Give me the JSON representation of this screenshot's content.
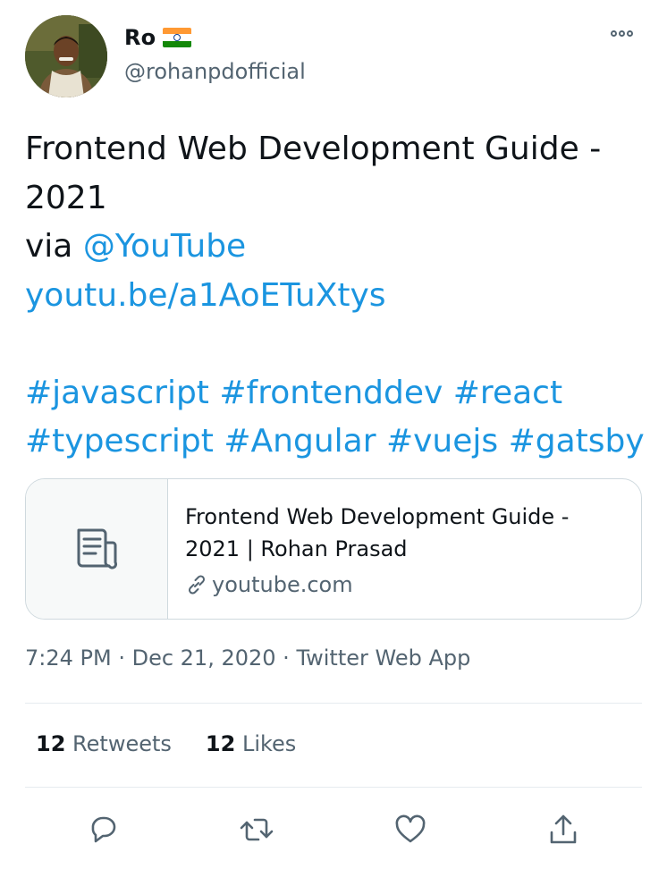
{
  "author": {
    "name": "Ro",
    "handle": "@rohanpdofficial",
    "flag": "india-flag-icon"
  },
  "tweet": {
    "line1": "Frontend Web Development Guide - 2021",
    "via_prefix": "via ",
    "mention": "@YouTube",
    "url": "youtu.be/a1AoETuXtys",
    "hashtags": [
      "#javascript",
      "#frontenddev",
      "#react",
      "#typescript",
      "#Angular",
      "#vuejs",
      "#gatsby"
    ]
  },
  "card": {
    "title": "Frontend Web Development Guide - 2021 | Rohan Prasad",
    "domain": "youtube.com"
  },
  "meta": {
    "time": "7:24 PM",
    "date": "Dec 21, 2020",
    "source": "Twitter Web App",
    "sep": " · "
  },
  "stats": {
    "retweets_count": "12",
    "retweets_label": "Retweets",
    "likes_count": "12",
    "likes_label": "Likes"
  },
  "colors": {
    "link": "#1b95e0",
    "text": "#0f1419",
    "secondary": "#536471",
    "border": "#cfd9de"
  },
  "icons": [
    "more-icon",
    "document-icon",
    "link-icon",
    "reply-icon",
    "retweet-icon",
    "like-icon",
    "share-icon"
  ]
}
